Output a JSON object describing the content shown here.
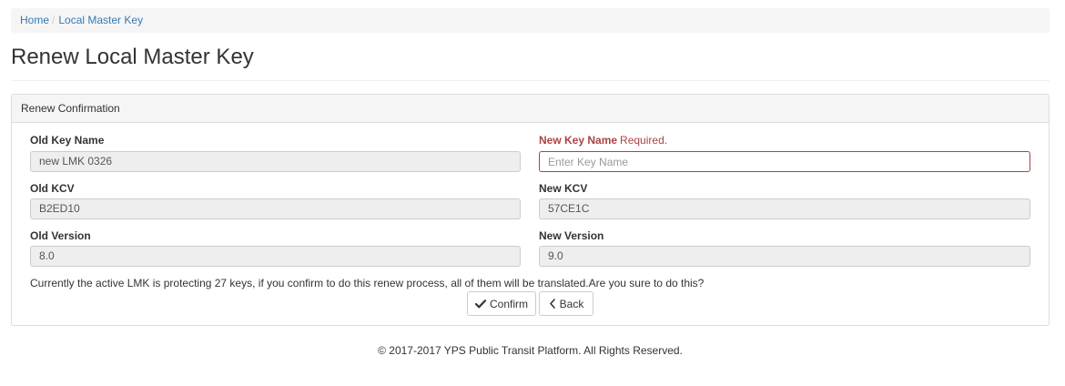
{
  "breadcrumb": {
    "home": "Home",
    "separator": "/",
    "current": "Local Master Key"
  },
  "page": {
    "title": "Renew Local Master Key"
  },
  "panel": {
    "heading": "Renew Confirmation"
  },
  "form": {
    "old_key_name": {
      "label": "Old Key Name",
      "value": "new LMK 0326"
    },
    "new_key_name": {
      "label": "New Key Name",
      "required_text": "Required.",
      "value": "",
      "placeholder": "Enter Key Name"
    },
    "old_kcv": {
      "label": "Old KCV",
      "value": "B2ED10"
    },
    "new_kcv": {
      "label": "New KCV",
      "value": "57CE1C"
    },
    "old_version": {
      "label": "Old Version",
      "value": "8.0"
    },
    "new_version": {
      "label": "New Version",
      "value": "9.0"
    }
  },
  "notice": "Currently the active LMK is protecting 27 keys, if you confirm to do this renew process, all of them will be translated.Are you sure to do this?",
  "buttons": {
    "confirm": {
      "label": "Confirm",
      "icon": "check-icon"
    },
    "back": {
      "label": "Back",
      "icon": "chevron-left-icon"
    }
  },
  "footer": "© 2017-2017 YPS Public Transit Platform. All Rights Reserved.",
  "colors": {
    "link": "#337ab7",
    "error": "#a94442",
    "readonly_bg": "#eeeeee",
    "panel_heading_bg": "#f5f5f5"
  }
}
